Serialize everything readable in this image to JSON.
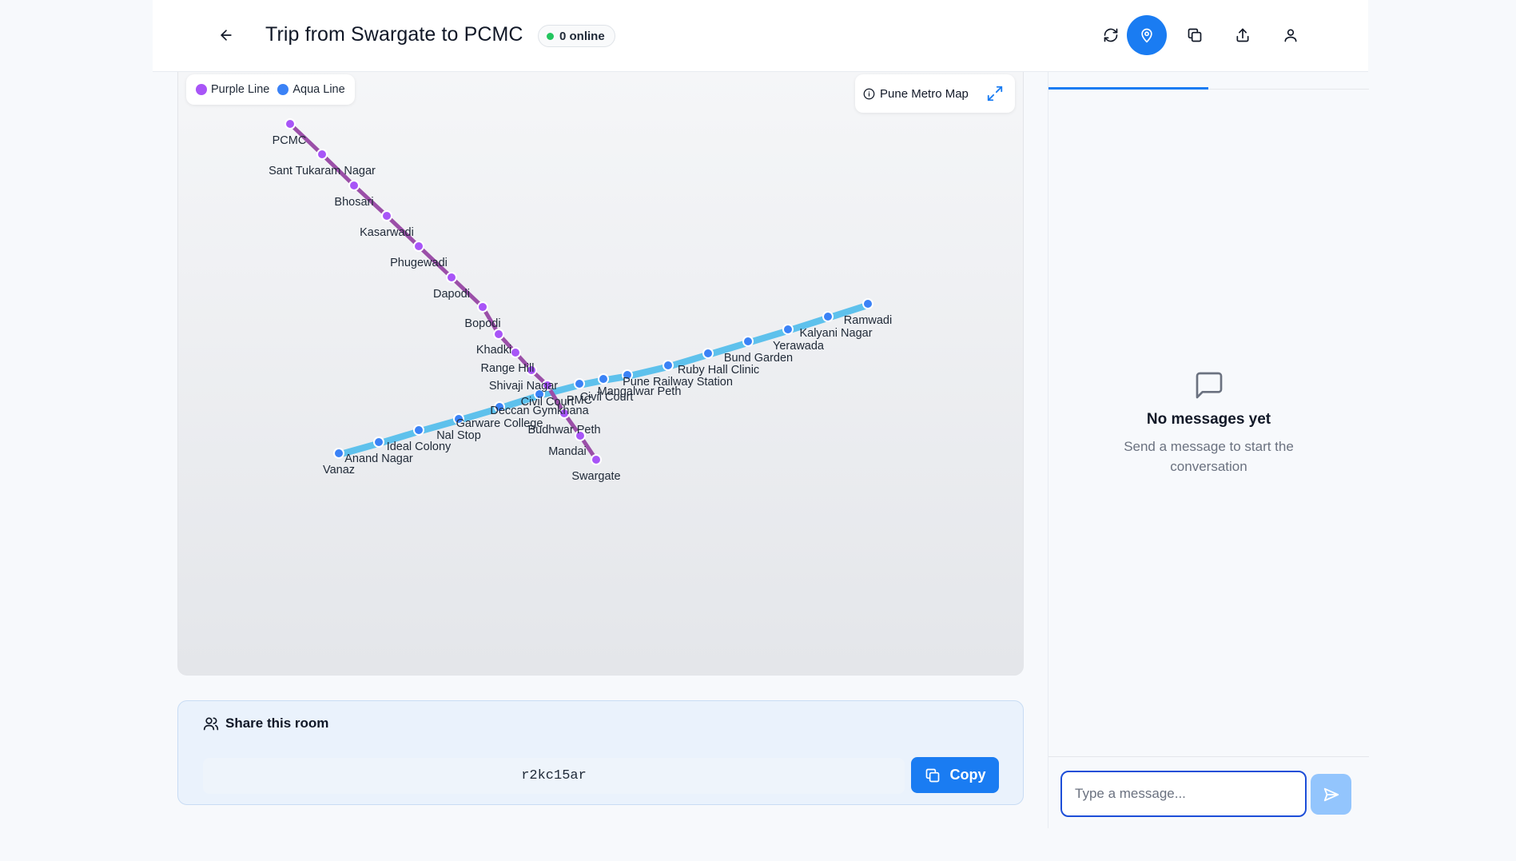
{
  "header": {
    "title": "Trip from Swargate to PCMC",
    "online_status": "0 online",
    "icons": [
      "back-arrow-icon",
      "refresh-icon",
      "location-pin-icon",
      "copy-icon",
      "share-icon",
      "user-icon"
    ]
  },
  "map": {
    "legend": [
      {
        "label": "Purple Line",
        "color": "#a855f7"
      },
      {
        "label": "Aqua Line",
        "color": "#3b82f6"
      }
    ],
    "title": "Pune Metro Map",
    "route_colors": {
      "purple": "#9b4fa8",
      "aqua": "#5ec1ec"
    },
    "purple_line": [
      {
        "name": "PCMC"
      },
      {
        "name": "Sant Tukaram Nagar"
      },
      {
        "name": "Bhosari"
      },
      {
        "name": "Kasarwadi"
      },
      {
        "name": "Phugewadi"
      },
      {
        "name": "Dapodi"
      },
      {
        "name": "Bopodi"
      },
      {
        "name": "Khadki"
      },
      {
        "name": "Range Hill"
      },
      {
        "name": "Shivaji Nagar"
      },
      {
        "name": "Civil Court"
      },
      {
        "name": "Budhwar Peth"
      },
      {
        "name": "Mandai"
      },
      {
        "name": "Swargate"
      }
    ],
    "aqua_line": [
      {
        "name": "Vanaz"
      },
      {
        "name": "Anand Nagar"
      },
      {
        "name": "Ideal Colony"
      },
      {
        "name": "Nal Stop"
      },
      {
        "name": "Garware College"
      },
      {
        "name": "Deccan Gymkhana"
      },
      {
        "name": "PMC"
      },
      {
        "name": "Civil Court"
      },
      {
        "name": "Mangalwar Peth"
      },
      {
        "name": "Pune Railway Station"
      },
      {
        "name": "Ruby Hall Clinic"
      },
      {
        "name": "Bund Garden"
      },
      {
        "name": "Yerawada"
      },
      {
        "name": "Kalyani Nagar"
      },
      {
        "name": "Ramwadi"
      }
    ]
  },
  "share": {
    "title": "Share this room",
    "room_code": "r2kc15ar",
    "copy_label": "Copy"
  },
  "chat": {
    "empty_title": "No messages yet",
    "empty_subtitle": "Send a message to start the conversation",
    "input_placeholder": "Type a message..."
  }
}
